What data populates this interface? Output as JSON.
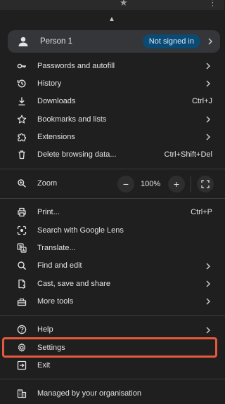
{
  "profile": {
    "name": "Person 1",
    "status": "Not signed in"
  },
  "section1": [
    {
      "label": "Passwords and autofill",
      "icon": "key-icon",
      "submenu": true
    },
    {
      "label": "History",
      "icon": "history-icon",
      "submenu": true
    },
    {
      "label": "Downloads",
      "icon": "download-icon",
      "shortcut": "Ctrl+J"
    },
    {
      "label": "Bookmarks and lists",
      "icon": "star-icon",
      "submenu": true
    },
    {
      "label": "Extensions",
      "icon": "puzzle-icon",
      "submenu": true
    },
    {
      "label": "Delete browsing data...",
      "icon": "trash-icon",
      "shortcut": "Ctrl+Shift+Del"
    }
  ],
  "zoom": {
    "label": "Zoom",
    "minus": "−",
    "value": "100%",
    "plus": "+"
  },
  "section3": [
    {
      "label": "Print...",
      "icon": "print-icon",
      "shortcut": "Ctrl+P"
    },
    {
      "label": "Search with Google Lens",
      "icon": "lens-icon"
    },
    {
      "label": "Translate...",
      "icon": "translate-icon"
    },
    {
      "label": "Find and edit",
      "icon": "find-icon",
      "submenu": true
    },
    {
      "label": "Cast, save and share",
      "icon": "cast-icon",
      "submenu": true
    },
    {
      "label": "More tools",
      "icon": "toolbox-icon",
      "submenu": true
    }
  ],
  "section4": [
    {
      "label": "Help",
      "icon": "help-icon",
      "submenu": true
    },
    {
      "label": "Settings",
      "icon": "gear-icon",
      "highlighted": true
    },
    {
      "label": "Exit",
      "icon": "exit-icon"
    }
  ],
  "footer": {
    "label": "Managed by your organisation",
    "icon": "building-icon"
  },
  "colors": {
    "background": "#1f1f1f",
    "profile_bg": "#35363a",
    "badge_bg": "#0b4a72",
    "highlight": "#e8583a"
  }
}
